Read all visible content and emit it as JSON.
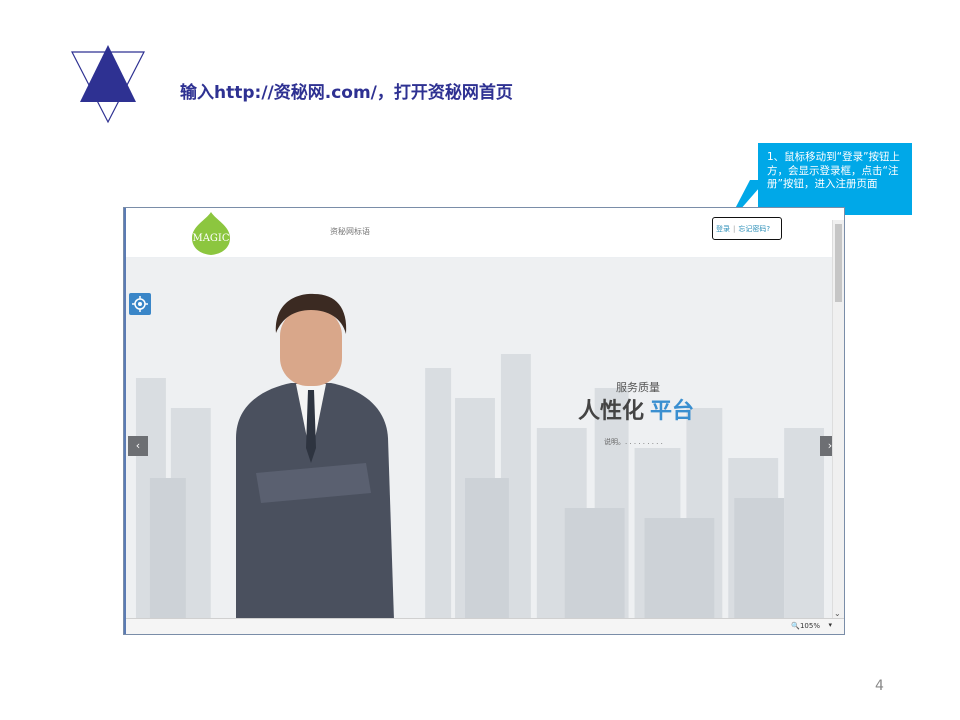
{
  "slide": {
    "title": "输入http://资秘网.com/，打开资秘网首页",
    "page_number": "4"
  },
  "callout": {
    "text": "1、鼠标移动到“登录”按钮上方，会显示登录框，点击“注册”按钮，进入注册页面"
  },
  "website": {
    "logo_text": "MAGIC",
    "slogan": "资秘网标语",
    "login_label": "登录",
    "forgot_label": "忘记密码?",
    "hero": {
      "subtitle": "服务质量",
      "main_part1": "人性化",
      "main_part2": "平台",
      "note": "说明。. . . . . . . . ."
    }
  },
  "browser": {
    "zoom": "🔍105%"
  },
  "colors": {
    "title": "#2e3192",
    "callout": "#00a8e8",
    "accent_blue": "#3a8fd0"
  }
}
